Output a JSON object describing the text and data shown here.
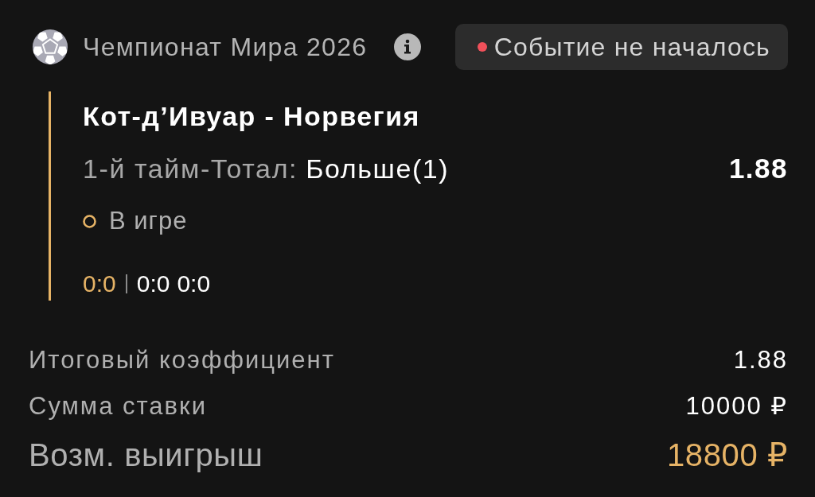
{
  "header": {
    "tournament": "Чемпионат Мира 2026",
    "event_status": "Событие не началось"
  },
  "bet": {
    "match": "Кот-д’Ивуар - Норвегия",
    "market": "1-й тайм-Тотал:",
    "outcome": "Больше(1)",
    "odds": "1.88",
    "state": "В игре",
    "score": {
      "current": "0:0",
      "periods": [
        "0:0",
        "0:0"
      ]
    }
  },
  "summary": [
    {
      "kind": "line",
      "label": "Итоговый коэффициент",
      "value": "1.88"
    },
    {
      "kind": "line",
      "label": "Сумма ставки",
      "value": "10000 ₽"
    },
    {
      "kind": "total",
      "label": "Возм. выигрыш",
      "value": "18800 ₽"
    }
  ]
}
